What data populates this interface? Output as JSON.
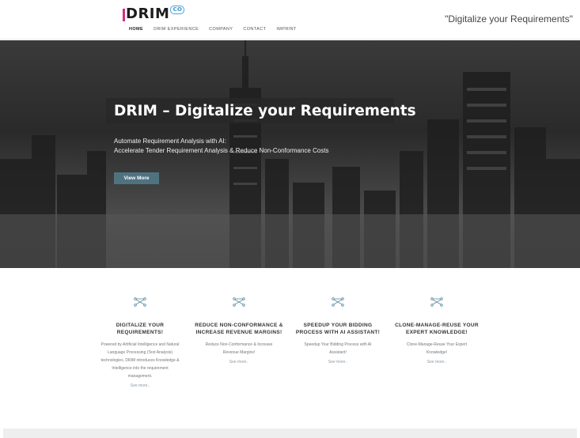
{
  "header": {
    "logo_text": "DRIM",
    "logo_suffix": "co",
    "tagline": "\"Digitalize your Requirements\"",
    "nav": [
      {
        "label": "HOME"
      },
      {
        "label": "DRIM EXPERIENCE"
      },
      {
        "label": "COMPANY"
      },
      {
        "label": "CONTACT"
      },
      {
        "label": "IMPRINT"
      }
    ]
  },
  "hero": {
    "title": "DRIM – Digitalize your Requirements",
    "line1": "Automate Requirement Analysis with AI:",
    "line2": "Accelerate Tender Requirement Analysis & Reduce Non-Conformance Costs",
    "button": "View More"
  },
  "features": [
    {
      "icon": "network-icon",
      "title_1": "DIGITALIZE YOUR",
      "title_2": "REQUIREMENTS!",
      "text_1": "Powered by Artificial Intelligence and Natural",
      "text_2": "Language Processing (Text Analysis)",
      "text_3": "technologies, DRIM introduces Knowledge &",
      "text_4": "Intelligence into the requirement",
      "text_5": "management.",
      "link": "See more.."
    },
    {
      "icon": "network-icon",
      "title_1": "REDUCE NON-CONFORMANCE &",
      "title_2": "INCREASE REVENUE MARGINS!",
      "text_1": "Reduce Non-Conformance & Increase",
      "text_2": "Revenue Margins!",
      "link": "See more.."
    },
    {
      "icon": "network-icon",
      "title_1": "SPEEDUP YOUR BIDDING",
      "title_2": "PROCESS WITH AI ASSISTANT!",
      "text_1": "Speedup Your Bidding Process with AI",
      "text_2": "Assistant!",
      "link": "See more.."
    },
    {
      "icon": "network-icon",
      "title_1": "CLONE-MANAGE-REUSE YOUR",
      "title_2": "EXPERT KNOWLEDGE!",
      "text_1": "Clone-Manage-Reuse Your Expert",
      "text_2": "Knowledge!",
      "link": "See more.."
    }
  ],
  "colors": {
    "accent_button": "#4f7280",
    "logo_bar": "#d92b8a",
    "logo_co": "#4aa3d8",
    "icon": "#5a8aa0"
  }
}
